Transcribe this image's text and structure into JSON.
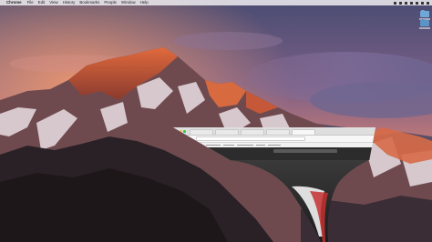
{
  "menubar": {
    "apple_glyph": "",
    "app_name": "Chrome",
    "items": [
      "File",
      "Edit",
      "View",
      "History",
      "Bookmarks",
      "People",
      "Window",
      "Help"
    ]
  },
  "colors": {
    "sky_top": "#5b5a7d",
    "sky_glow": "#e07a5f",
    "mountain_lit": "#c4502f",
    "snow": "#f2e8e8",
    "rock_dark": "#3a2c34",
    "menubar_bg": "#ebe8ec",
    "folder_blue": "#6fa7d9"
  },
  "desktop_icons": [
    {
      "icon": "folder-icon"
    },
    {
      "icon": "folder-icon"
    }
  ],
  "window": {
    "state": "minimizing (genie effect)",
    "traffic_lights": [
      "close",
      "minimize",
      "zoom"
    ]
  }
}
